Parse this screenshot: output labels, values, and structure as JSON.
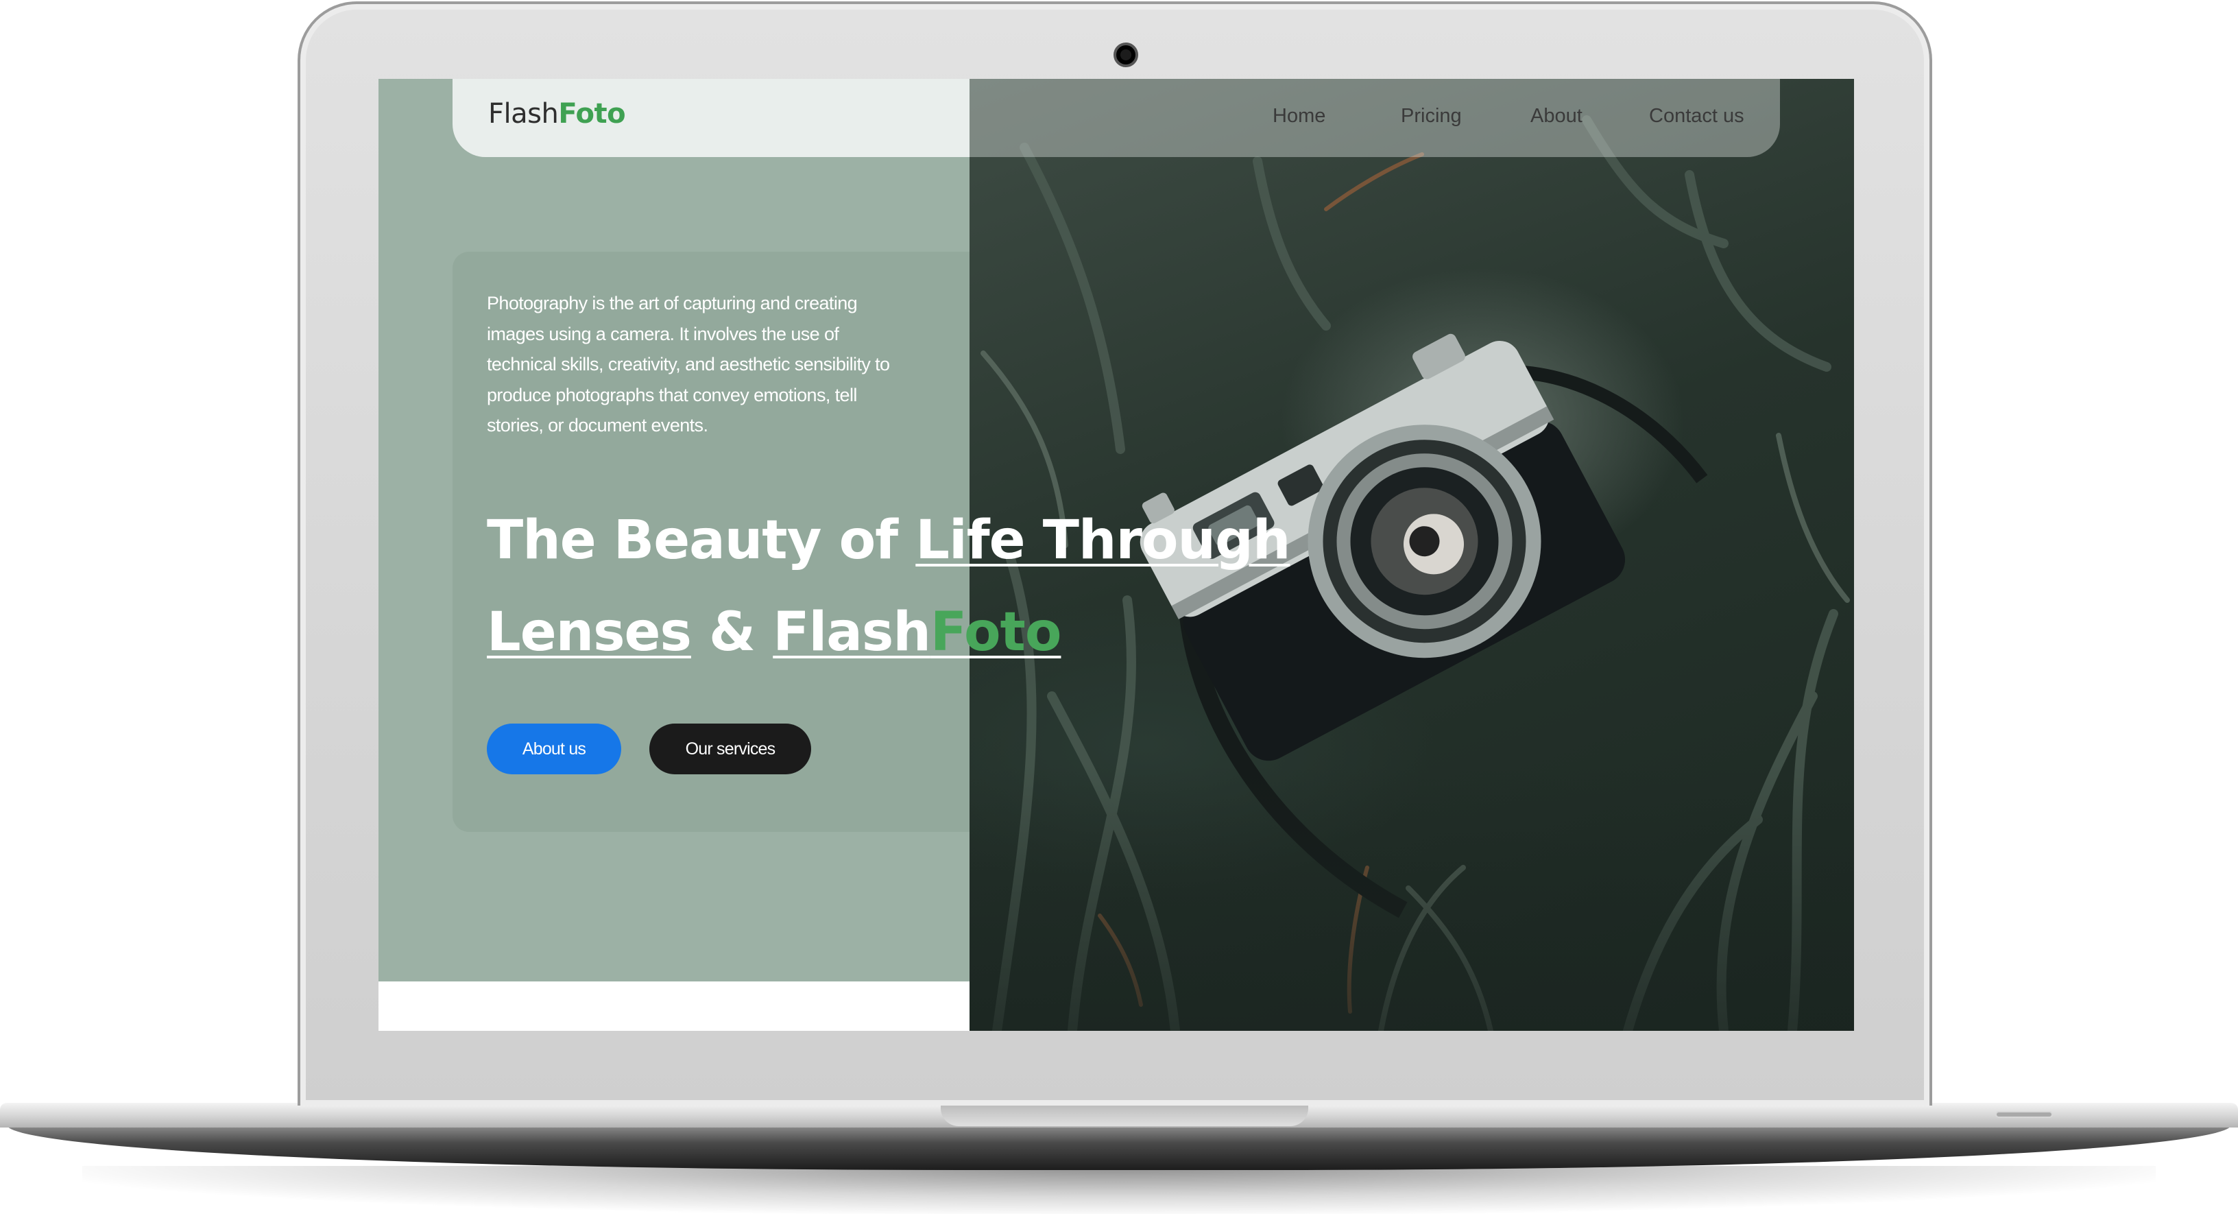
{
  "brand": {
    "part1": "Flash",
    "part2": "Foto"
  },
  "nav": {
    "items": [
      {
        "label": "Home"
      },
      {
        "label": "Pricing"
      },
      {
        "label": "About"
      },
      {
        "label": "Contact us"
      }
    ]
  },
  "hero": {
    "description": "Photography is the art of capturing and creating images using a camera. It involves the use of technical skills, creativity, and aesthetic sensibility to produce photographs that convey emotions, tell stories, or document events.",
    "title": {
      "line1_plain": "The Beauty of ",
      "line1_underlined": "Life Through",
      "line2_underlined": "Lenses",
      "line2_amp": " & ",
      "line2_brand1": "Flash",
      "line2_brand2": "Foto"
    },
    "buttons": {
      "about": "About us",
      "services": "Our services"
    }
  },
  "colors": {
    "panel": "#9cb1a5",
    "brand_green": "#3fa152",
    "about_button": "#1677e8",
    "services_button": "#1b1b1b"
  },
  "icons": {
    "webcam": "camera-dot",
    "photo": "vintage-camera-in-grass"
  }
}
